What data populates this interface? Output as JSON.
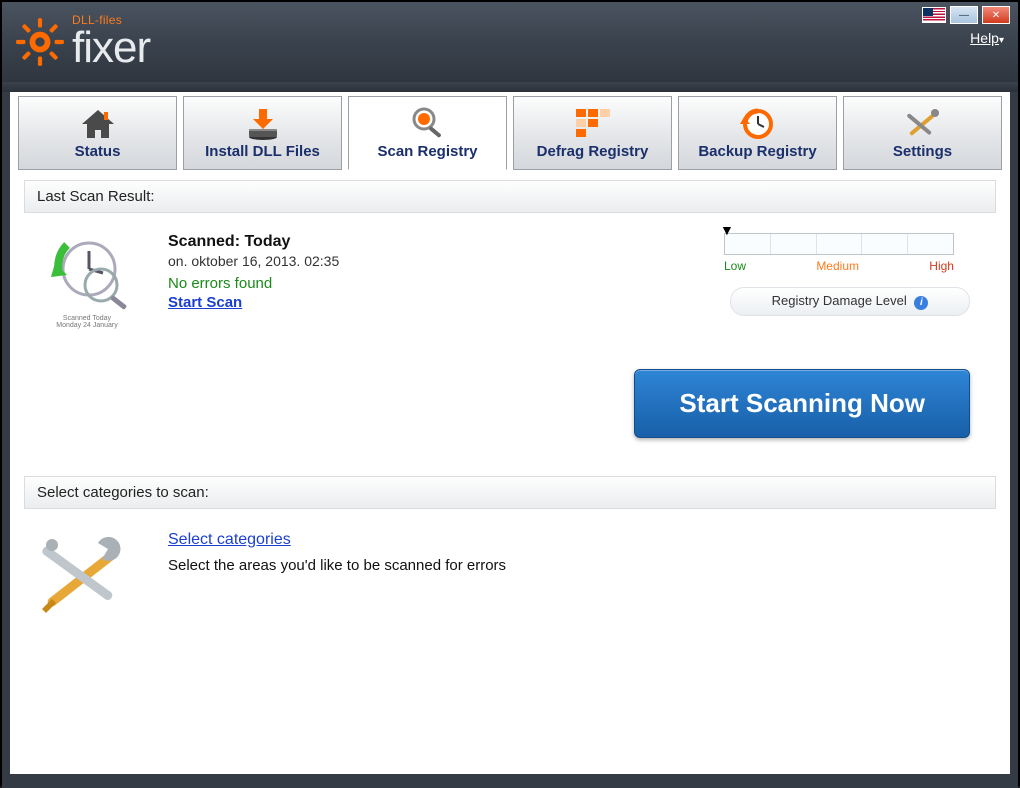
{
  "app": {
    "brand_sub": "DLL-files",
    "brand_main": "fixer",
    "help_label": "Help"
  },
  "tabs": {
    "items": [
      {
        "label": "Status"
      },
      {
        "label": "Install DLL Files"
      },
      {
        "label": "Scan Registry"
      },
      {
        "label": "Defrag Registry"
      },
      {
        "label": "Backup Registry"
      },
      {
        "label": "Settings"
      }
    ],
    "active_index": 2
  },
  "scan": {
    "section_title": "Last Scan Result:",
    "scanned_label": "Scanned: Today",
    "scanned_date": "on. oktober 16, 2013. 02:35",
    "status_text": "No errors found",
    "start_scan_link": "Start Scan",
    "gauge": {
      "low": "Low",
      "medium": "Medium",
      "high": "High",
      "pill_label": "Registry Damage Level"
    },
    "big_button": "Start Scanning Now"
  },
  "categories": {
    "section_title": "Select categories to scan:",
    "link": "Select categories",
    "desc": "Select the areas you'd like to be scanned for errors"
  }
}
